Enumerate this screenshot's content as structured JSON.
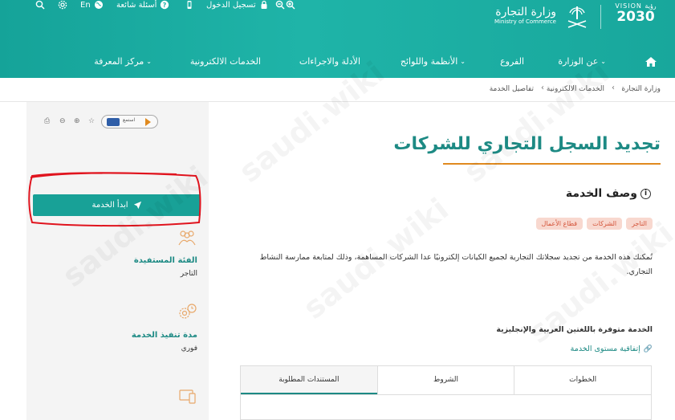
{
  "header": {
    "vision_small": "VISION رؤية",
    "vision_year": "2030",
    "ministry_ar": "وزارة التجارة",
    "ministry_en": "Ministry of Commerce",
    "top_links": {
      "login": "تسجيل الدخول",
      "faq": "أسئلة شائعة",
      "lang": "En"
    }
  },
  "nav": {
    "items": [
      {
        "label": "عن الوزارة",
        "dropdown": true
      },
      {
        "label": "الفروع",
        "dropdown": false
      },
      {
        "label": "الأنظمة واللوائح",
        "dropdown": true
      },
      {
        "label": "الأدلة والاجراءات",
        "dropdown": false
      },
      {
        "label": "الخدمات الالكترونية",
        "dropdown": false
      },
      {
        "label": "مركز المعرفة",
        "dropdown": true
      }
    ]
  },
  "breadcrumb": [
    "وزارة التجارة",
    "الخدمات الالكترونية",
    "تفاصيل الخدمة"
  ],
  "listen": {
    "label": "استمع"
  },
  "page": {
    "title": "تجديد السجل التجاري للشركات",
    "section_title": "وصف الخدمة",
    "tags": [
      "التاجر",
      "الشركات",
      "قطاع الأعمال"
    ],
    "description": "تُمكنك هذه الخدمة من تجديد سجلاتك التجارية لجميع الكيانات إلكترونيًا عدا الشركات المساهمة، وذلك لمتابعة ممارسة النشاط التجاري.",
    "lang_note": "الخدمة متوفرة باللغتين العربية والإنجليزية",
    "sla_link": "إتفاقية مستوى الخدمة",
    "tabs": [
      {
        "label": "الخطوات",
        "active": false
      },
      {
        "label": "الشروط",
        "active": false
      },
      {
        "label": "المستندات المطلوبة",
        "active": true
      }
    ]
  },
  "sidebar": {
    "start_button": "ابدأ الخدمة",
    "target_label": "الفئة المستفيدة",
    "target_value": "التاجر",
    "duration_label": "مدة تنفيذ الخدمة",
    "duration_value": "فوري"
  },
  "watermark": "saudi.wiki",
  "colors": {
    "primary": "#18a197",
    "accent": "#e08a1f",
    "tag_bg": "#f8d8cf",
    "tag_text": "#d4553b",
    "highlight_ring": "#e0141e"
  }
}
